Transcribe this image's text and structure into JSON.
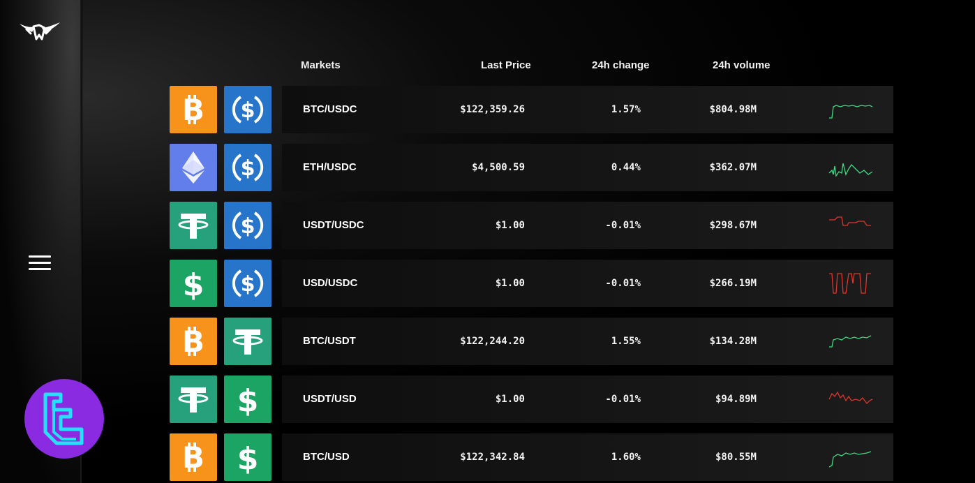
{
  "sidebar": {
    "logo_icon": "bull-horns-logo",
    "menu_icon": "hamburger-menu-icon",
    "badge_icon": "tc-logo-badge"
  },
  "table": {
    "headers": {
      "markets": "Markets",
      "last_price": "Last Price",
      "change_24h": "24h change",
      "volume_24h": "24h volume"
    },
    "rows": [
      {
        "base": "bitcoin",
        "quote": "usdc",
        "pair": "BTC/USDC",
        "price": "$122,359.26",
        "change": "1.57%",
        "volume": "$804.98M",
        "trend": "up"
      },
      {
        "base": "ethereum",
        "quote": "usdc",
        "pair": "ETH/USDC",
        "price": "$4,500.59",
        "change": "0.44%",
        "volume": "$362.07M",
        "trend": "up"
      },
      {
        "base": "tether",
        "quote": "usdc",
        "pair": "USDT/USDC",
        "price": "$1.00",
        "change": "-0.01%",
        "volume": "$298.67M",
        "trend": "down"
      },
      {
        "base": "usd",
        "quote": "usdc",
        "pair": "USD/USDC",
        "price": "$1.00",
        "change": "-0.01%",
        "volume": "$266.19M",
        "trend": "down"
      },
      {
        "base": "bitcoin",
        "quote": "tether",
        "pair": "BTC/USDT",
        "price": "$122,244.20",
        "change": "1.55%",
        "volume": "$134.28M",
        "trend": "up"
      },
      {
        "base": "tether",
        "quote": "usd",
        "pair": "USDT/USD",
        "price": "$1.00",
        "change": "-0.01%",
        "volume": "$94.89M",
        "trend": "down"
      },
      {
        "base": "bitcoin",
        "quote": "usd",
        "pair": "BTC/USD",
        "price": "$122,342.84",
        "change": "1.60%",
        "volume": "$80.55M",
        "trend": "up"
      }
    ]
  },
  "colors": {
    "bitcoin": "#f7931a",
    "ethereum": "#627eea",
    "usdc": "#2775ca",
    "tether": "#26a17b",
    "usd": "#1ba463",
    "up": "#3ddc84",
    "down": "#e0352b",
    "badge": "#8a2be2"
  }
}
